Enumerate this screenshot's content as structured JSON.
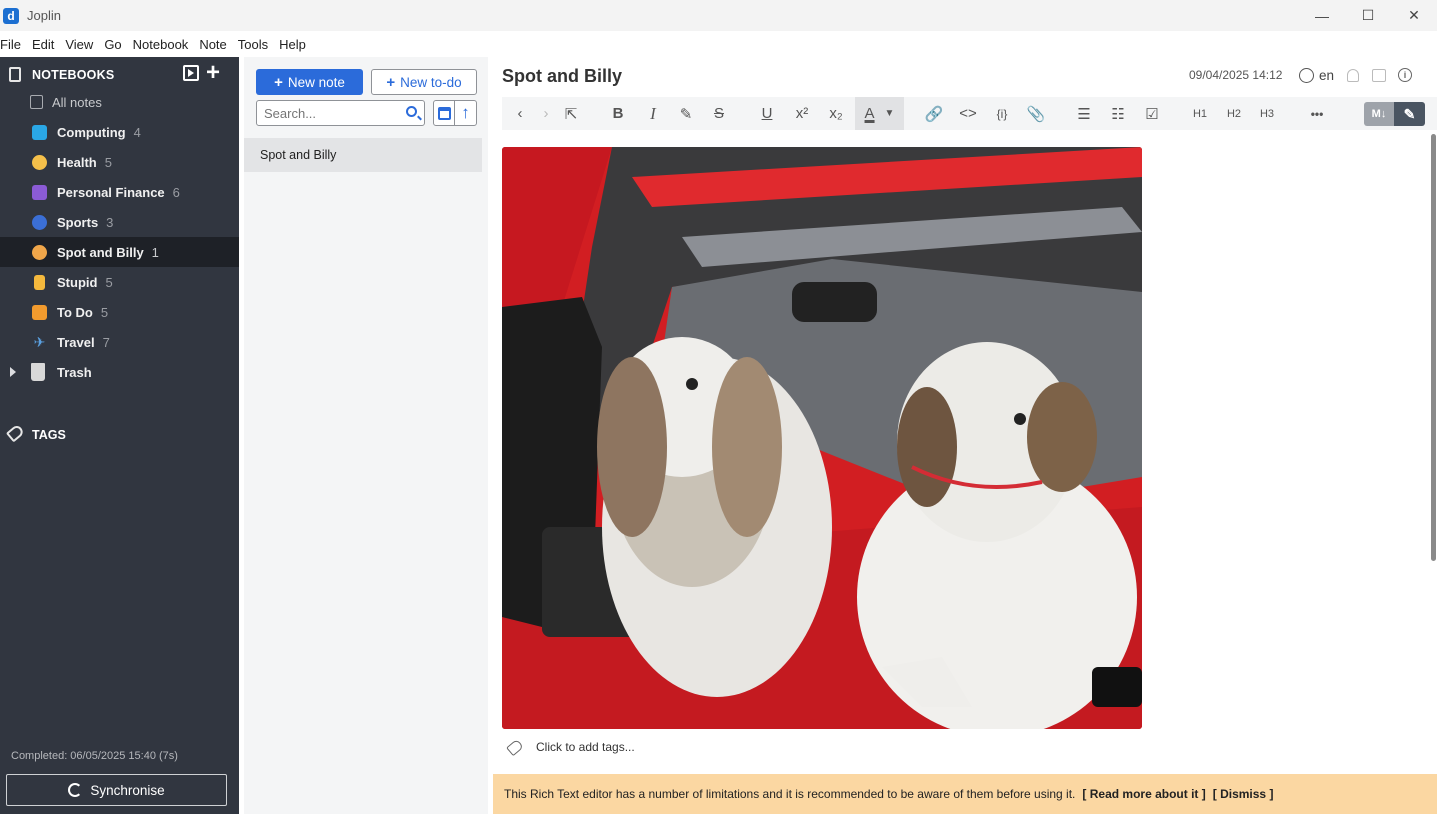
{
  "window": {
    "title": "Joplin",
    "minimize": "—",
    "maximize": "☐",
    "close": "✕"
  },
  "menu": [
    "File",
    "Edit",
    "View",
    "Go",
    "Notebook",
    "Note",
    "Tools",
    "Help"
  ],
  "sidebar": {
    "notebooks_title": "NOTEBOOKS",
    "all_notes": "All notes",
    "notebooks": [
      {
        "label": "Computing",
        "count": "4",
        "icon": "computer-icon",
        "color": "#2aa7e6"
      },
      {
        "label": "Health",
        "count": "5",
        "icon": "face-icon",
        "color": "#f5c04a"
      },
      {
        "label": "Personal Finance",
        "count": "6",
        "icon": "money-icon",
        "color": "#8b5bd6"
      },
      {
        "label": "Sports",
        "count": "3",
        "icon": "soccer-ball-icon",
        "color": "#3b6fd6"
      },
      {
        "label": "Spot and Billy",
        "count": "1",
        "icon": "dog-icon",
        "color": "#f0a64a",
        "active": true
      },
      {
        "label": "Stupid",
        "count": "5",
        "icon": "thumbs-down-icon",
        "color": "#f5b93d"
      },
      {
        "label": "To Do",
        "count": "5",
        "icon": "todo-icon",
        "color": "#f29b2e"
      },
      {
        "label": "Travel",
        "count": "7",
        "icon": "airplane-icon",
        "color": "#5aa0e0"
      }
    ],
    "trash": "Trash",
    "tags_title": "TAGS",
    "sync_status": "Completed: 06/05/2025 15:40 (7s)",
    "sync_button": "Synchronise"
  },
  "notelist": {
    "new_note": "New note",
    "new_todo": "New to-do",
    "search_placeholder": "Search...",
    "notes": [
      "Spot and Billy"
    ]
  },
  "editor": {
    "title": "Spot and Billy",
    "date": "09/04/2025 14:12",
    "language": "en",
    "toolbar": {
      "h1": "H1",
      "h2": "H2",
      "h3": "H3",
      "more": "•••"
    },
    "tags_placeholder": "Click to add tags...",
    "banner_text": "This Rich Text editor has a number of limitations and it is recommended to be aware of them before using it.",
    "banner_read_more": "[ Read more about it ]",
    "banner_dismiss": "[ Dismiss ]"
  }
}
